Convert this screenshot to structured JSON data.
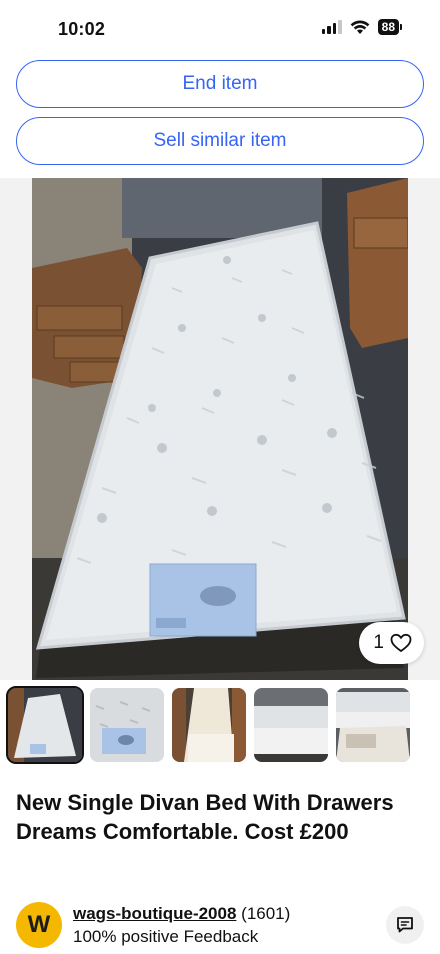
{
  "status_bar": {
    "time": "10:02",
    "battery": "88"
  },
  "actions": {
    "end_item": "End item",
    "sell_similar": "Sell similar item"
  },
  "gallery": {
    "favorite_count": "1",
    "thumbnail_count": 5,
    "selected_index": 0
  },
  "listing": {
    "title": "New Single Divan Bed With Drawers Dreams Comfortable. Cost £200"
  },
  "seller": {
    "avatar_letter": "W",
    "name": "wags-boutique-2008",
    "count": "(1601)",
    "feedback": "100% positive Feedback"
  },
  "colors": {
    "accent": "#3665f3",
    "avatar": "#f5b800"
  }
}
